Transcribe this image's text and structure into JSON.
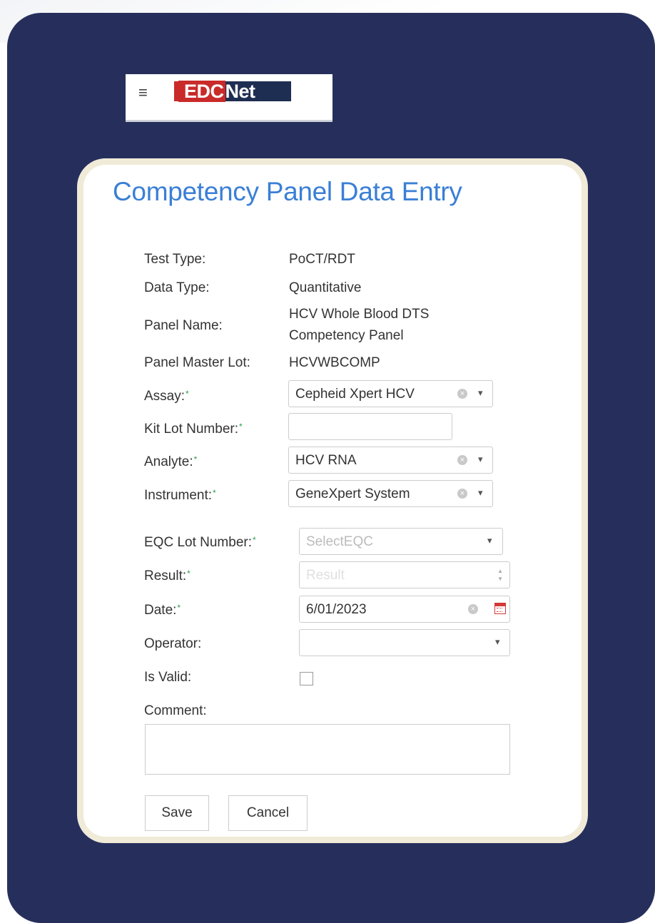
{
  "header": {
    "logo_text_a": "EDC",
    "logo_text_b": "Net"
  },
  "page": {
    "title": "Competency Panel Data Entry"
  },
  "info": [
    {
      "label": "Test Type:",
      "value": "PoCT/RDT"
    },
    {
      "label": "Data Type:",
      "value": "Quantitative"
    },
    {
      "label": "Panel Name:",
      "value_line1": "HCV Whole Blood DTS",
      "value_line2": "Competency Panel"
    },
    {
      "label": "Panel Master Lot:",
      "value": "HCVWBCOMP"
    }
  ],
  "fields": {
    "assay": {
      "label": "Assay:",
      "value": "Cepheid Xpert HCV"
    },
    "kit_lot": {
      "label": "Kit Lot Number:",
      "value": ""
    },
    "analyte": {
      "label": "Analyte:",
      "value": "HCV RNA"
    },
    "instrument": {
      "label": "Instrument:",
      "value": "GeneXpert System"
    },
    "eqc_lot": {
      "label": "EQC Lot Number:",
      "placeholder": "SelectEQC"
    },
    "result": {
      "label": "Result:",
      "placeholder": "Result"
    },
    "date": {
      "label": "Date:",
      "value": "6/01/2023"
    },
    "operator": {
      "label": "Operator:",
      "value": ""
    },
    "is_valid": {
      "label": "Is Valid:",
      "checked": false
    },
    "comment": {
      "label": "Comment:",
      "value": ""
    }
  },
  "required_marker": "*",
  "buttons": {
    "save": "Save",
    "cancel": "Cancel"
  },
  "colors": {
    "background": "#262f5c",
    "card_border": "#f0ead8",
    "title": "#3a7fd6",
    "required": "#2ba14a",
    "logo_bg": "#1e2e52",
    "logo_accent": "#c92a2a"
  },
  "icons": {
    "menu": "hamburger-icon",
    "clear": "clear-circle-icon",
    "dropdown": "chevron-down-icon",
    "calendar": "calendar-icon",
    "spinner": "spinner-arrows-icon"
  }
}
